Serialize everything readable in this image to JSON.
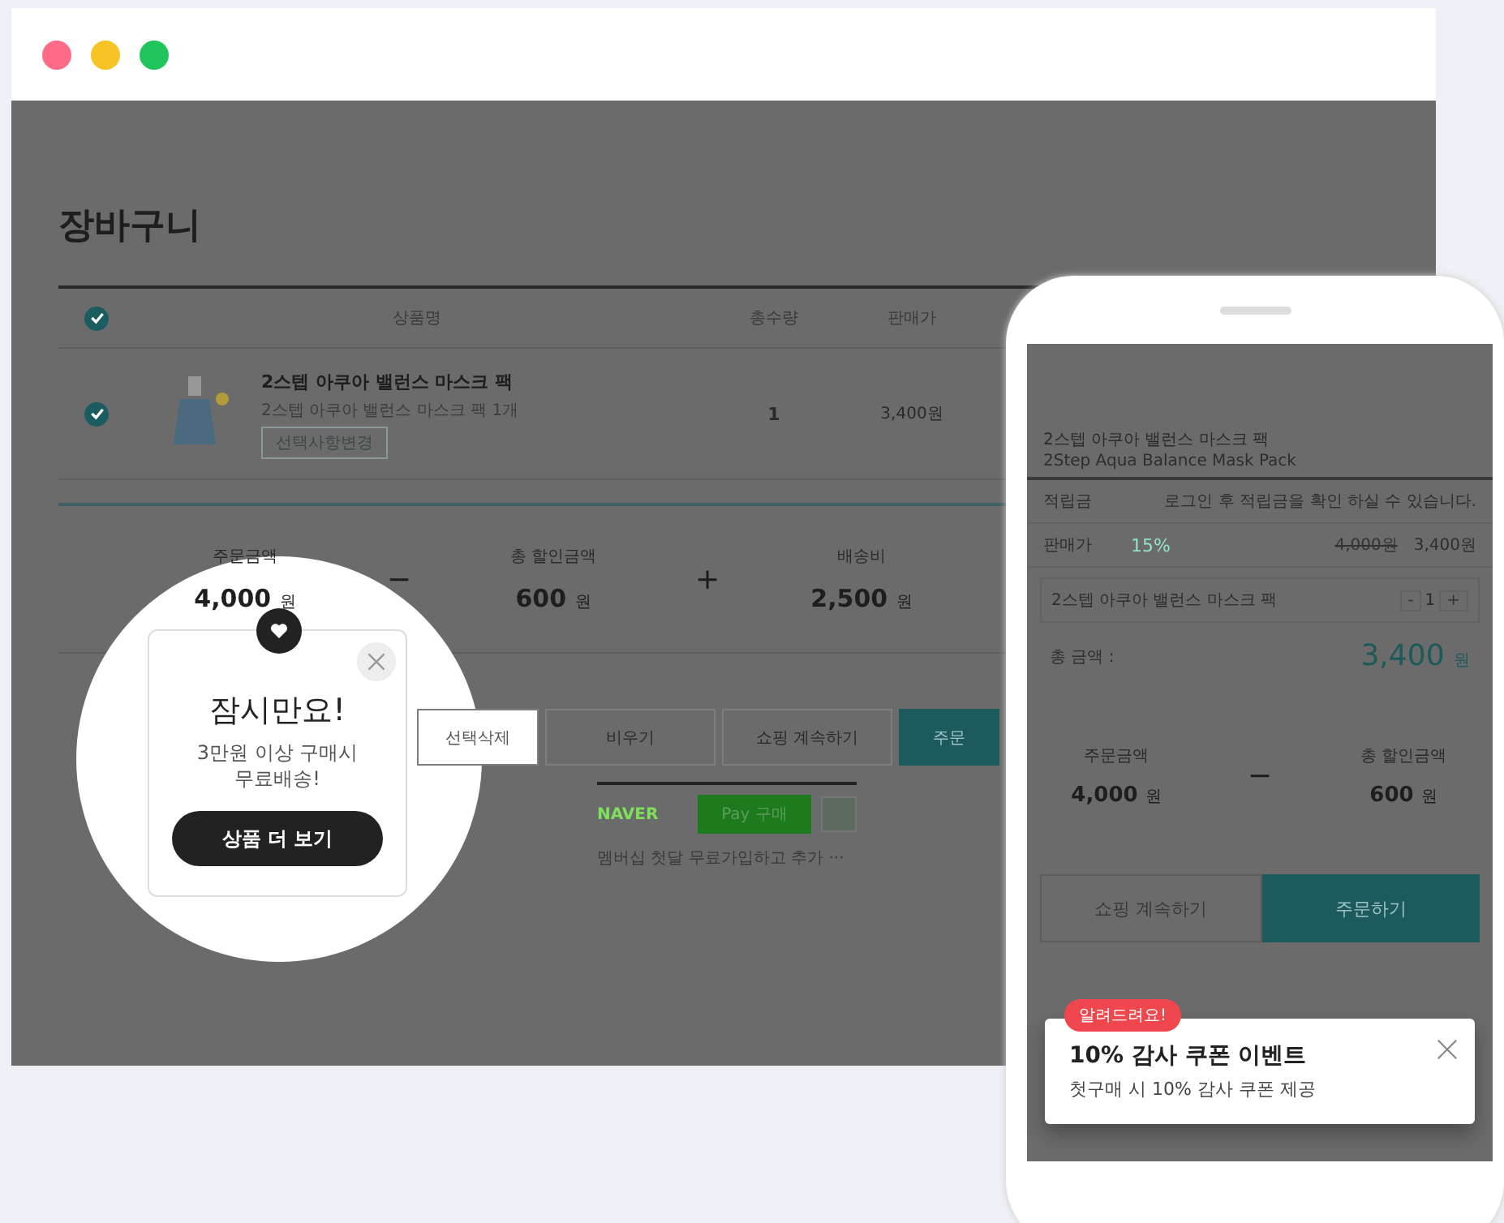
{
  "browser": {
    "page_title": "장바구니",
    "all_checked": true,
    "columns": [
      "상품명",
      "총수량",
      "판매가"
    ],
    "items": [
      {
        "checked": true,
        "name": "2스텝 아쿠아 밸런스 마스크 팩",
        "option": "2스텝 아쿠아 밸런스 마스크 팩 1개",
        "option_button": "선택사항변경",
        "quantity": "1",
        "price": "3,400원"
      }
    ],
    "summary": [
      {
        "label": "주문금액",
        "amount": "4,000",
        "unit": "원"
      },
      {
        "label": "총 할인금액",
        "amount": "600",
        "unit": "원"
      },
      {
        "label": "배송비",
        "amount": "2,500",
        "unit": "원"
      }
    ],
    "operators": [
      "−",
      "+"
    ],
    "buttons": [
      {
        "label": "선택삭제",
        "kind": "outline"
      },
      {
        "label": "비우기",
        "kind": "outline"
      },
      {
        "label": "쇼핑 계속하기",
        "kind": "outline"
      },
      {
        "label": "주문",
        "kind": "primary"
      }
    ],
    "naver_pay": {
      "brand": "NAVER",
      "button": "Pay 구매",
      "promo": "멤버십 첫달 무료가입하고 추가 ···"
    }
  },
  "popup": {
    "title": "잠시만요!",
    "message": "3만원 이상 구매시 무료배송!",
    "button": "상품 더 보기"
  },
  "phone": {
    "product_name": "2스텝 아쿠아 밸런스 마스크 팩",
    "product_name_en": "2Step Aqua Balance Mask Pack",
    "points_label": "적립금",
    "points_value": "로그인 후 적립금을 확인 하실 수 있습니다.",
    "price_label": "판매가",
    "discount": "15%",
    "original_price": "4,000원",
    "price": "3,400원",
    "option_name": "2스텝 아쿠아 밸런스 마스크 팩",
    "qty_minus": "-",
    "quantity": "1",
    "qty_plus": "+",
    "total_label": "총 금액 :",
    "total": "3,400",
    "total_unit": "원",
    "summary": [
      {
        "label": "주문금액",
        "amount": "4,000",
        "unit": "원"
      },
      {
        "label": "총 할인금액",
        "amount": "600",
        "unit": "원"
      }
    ],
    "operator": "−",
    "buttons": [
      {
        "label": "쇼핑 계속하기",
        "kind": "outline"
      },
      {
        "label": "주문하기",
        "kind": "primary"
      }
    ],
    "toast": {
      "badge": "알려드려요!",
      "title": "10% 감사 쿠폰 이벤트",
      "message": "첫구매 시 10% 감사 쿠폰 제공"
    }
  }
}
